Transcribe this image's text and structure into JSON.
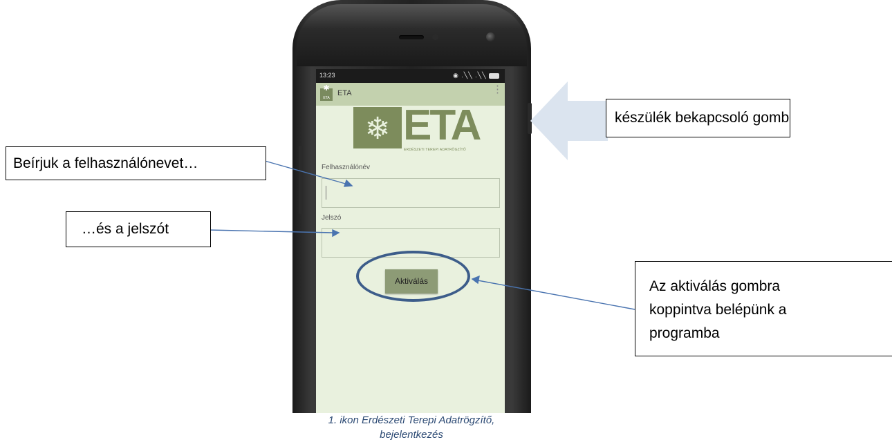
{
  "phone": {
    "status_time": "13:23",
    "status_icons": "◉ .╲╲ .╲╲",
    "app_title": "ETA",
    "app_icon_text": "ETA",
    "logo_text": "ETA",
    "logo_subtitle": "ERDÉSZETI TEREPI ADATRÖGZÍTŐ",
    "username_label": "Felhasználónév",
    "username_value": "",
    "password_label": "Jelszó",
    "password_value": "",
    "activate_button": "Aktiválás",
    "menu_icon": "⋮"
  },
  "annotations": {
    "power_button_note": "készülék bekapcsoló gomb",
    "username_note": "Beírjuk a felhasználónevet…",
    "password_note": "…és a jelszót",
    "activate_note": "Az aktiválás gombra koppintva belépünk a programba"
  },
  "caption": {
    "line1": "1. ikon Erdészeti Terepi Adatrögzítő,",
    "line2": "bejelentkezés"
  },
  "colors": {
    "screen_bg": "#e9f1de",
    "appbar_bg": "#c3d1ae",
    "logo_green": "#7d8c5c",
    "button_bg": "#8d9b76",
    "annotation_blue": "#3d5d8a",
    "arrow_fill": "#dbe4ef",
    "caption_color": "#2c4a74"
  }
}
